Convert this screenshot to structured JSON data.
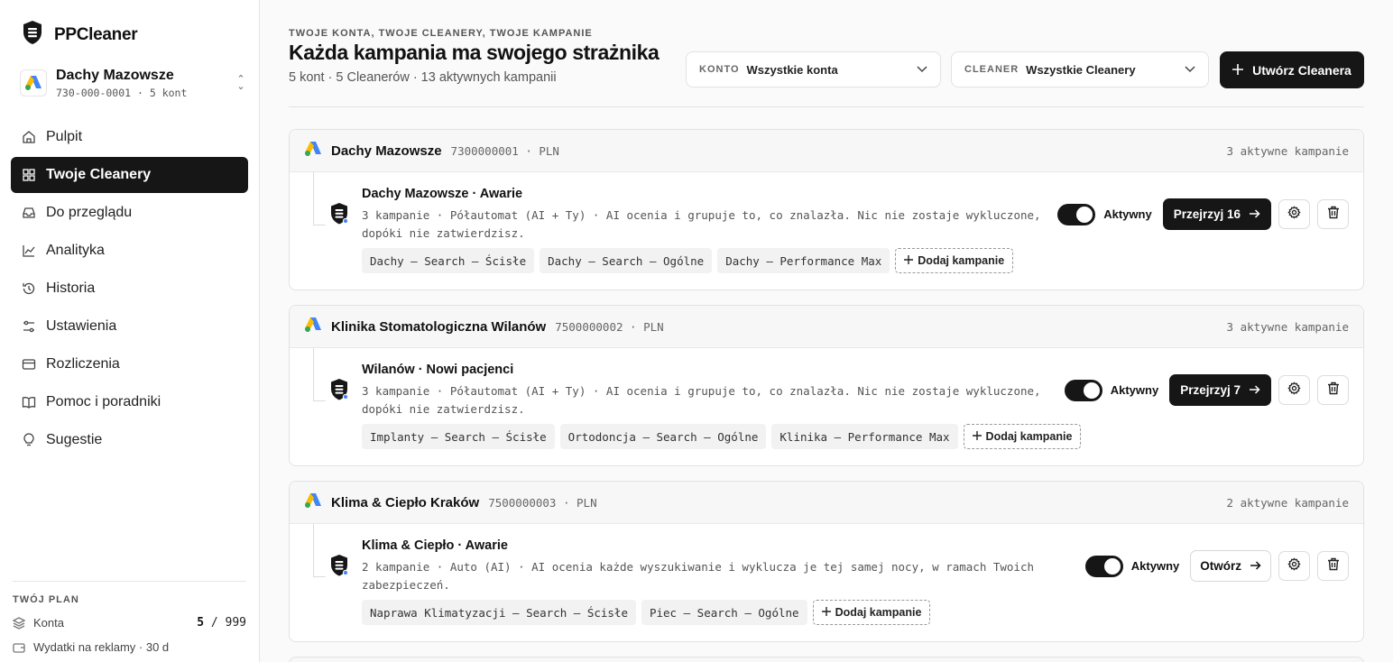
{
  "brand": {
    "name": "PPCleaner"
  },
  "account": {
    "name": "Dachy Mazowsze",
    "sub": "730-000-0001 · 5 kont"
  },
  "nav": [
    {
      "label": "Pulpit",
      "icon": "home-icon",
      "active": false
    },
    {
      "label": "Twoje Cleanery",
      "icon": "grid-icon",
      "active": true
    },
    {
      "label": "Do przeglądu",
      "icon": "inbox-icon",
      "active": false
    },
    {
      "label": "Analityka",
      "icon": "chart-line-icon",
      "active": false
    },
    {
      "label": "Historia",
      "icon": "history-icon",
      "active": false
    },
    {
      "label": "Ustawienia",
      "icon": "sliders-icon",
      "active": false
    },
    {
      "label": "Rozliczenia",
      "icon": "credit-card-icon",
      "active": false
    },
    {
      "label": "Pomoc i poradniki",
      "icon": "book-icon",
      "active": false
    },
    {
      "label": "Sugestie",
      "icon": "lightbulb-icon",
      "active": false
    }
  ],
  "plan": {
    "title": "TWÓJ PLAN",
    "accounts_label": "Konta",
    "accounts_used": "5",
    "accounts_sep": "/",
    "accounts_max": "999",
    "spend_label": "Wydatki na reklamy · 30 d"
  },
  "header": {
    "eyebrow": "TWOJE KONTA, TWOJE CLEANERY, TWOJE KAMPANIE",
    "title": "Każda kampania ma swojego strażnika",
    "subtitle": "5 kont · 5 Cleanerów · 13 aktywnych kampanii",
    "filter_account_label": "KONTO",
    "filter_account_value": "Wszystkie konta",
    "filter_cleaner_label": "CLEANER",
    "filter_cleaner_value": "Wszystkie Cleanery",
    "create_label": "Utwórz Cleanera"
  },
  "colors": {
    "accent": "#161616",
    "google_blue": "#4285F4",
    "google_yellow": "#FBBC04",
    "google_green": "#34A853"
  },
  "cards": [
    {
      "account_name": "Dachy Mazowsze",
      "account_meta": "7300000001 · PLN",
      "count": "3 aktywne kampanie",
      "cleaner_name": "Dachy Mazowsze · Awarie",
      "cleaner_desc": "3 kampanie · Półautomat (AI + Ty) · AI ocenia i grupuje to, co znalazła. Nic nie zostaje wykluczone, dopóki nie zatwierdzisz.",
      "status": "Aktywny",
      "button": "Przejrzyj 16",
      "button_type": "review",
      "chips": [
        "Dachy — Search — Ścisłe",
        "Dachy — Search — Ogólne",
        "Dachy — Performance Max"
      ],
      "add_label": "Dodaj kampanie"
    },
    {
      "account_name": "Klinika Stomatologiczna Wilanów",
      "account_meta": "7500000002 · PLN",
      "count": "3 aktywne kampanie",
      "cleaner_name": "Wilanów · Nowi pacjenci",
      "cleaner_desc": "3 kampanie · Półautomat (AI + Ty) · AI ocenia i grupuje to, co znalazła. Nic nie zostaje wykluczone, dopóki nie zatwierdzisz.",
      "status": "Aktywny",
      "button": "Przejrzyj 7",
      "button_type": "review",
      "chips": [
        "Implanty — Search — Ścisłe",
        "Ortodoncja — Search — Ogólne",
        "Klinika — Performance Max"
      ],
      "add_label": "Dodaj kampanie"
    },
    {
      "account_name": "Klima & Ciepło Kraków",
      "account_meta": "7500000003 · PLN",
      "count": "2 aktywne kampanie",
      "cleaner_name": "Klima & Ciepło · Awarie",
      "cleaner_desc": "2 kampanie · Auto (AI) · AI ocenia każde wyszukiwanie i wyklucza je tej samej nocy, w ramach Twoich zabezpieczeń.",
      "status": "Aktywny",
      "button": "Otwórz",
      "button_type": "open",
      "chips": [
        "Naprawa Klimatyzacji — Search — Ścisłe",
        "Piec — Search — Ogólne"
      ],
      "add_label": "Dodaj kampanie"
    }
  ]
}
